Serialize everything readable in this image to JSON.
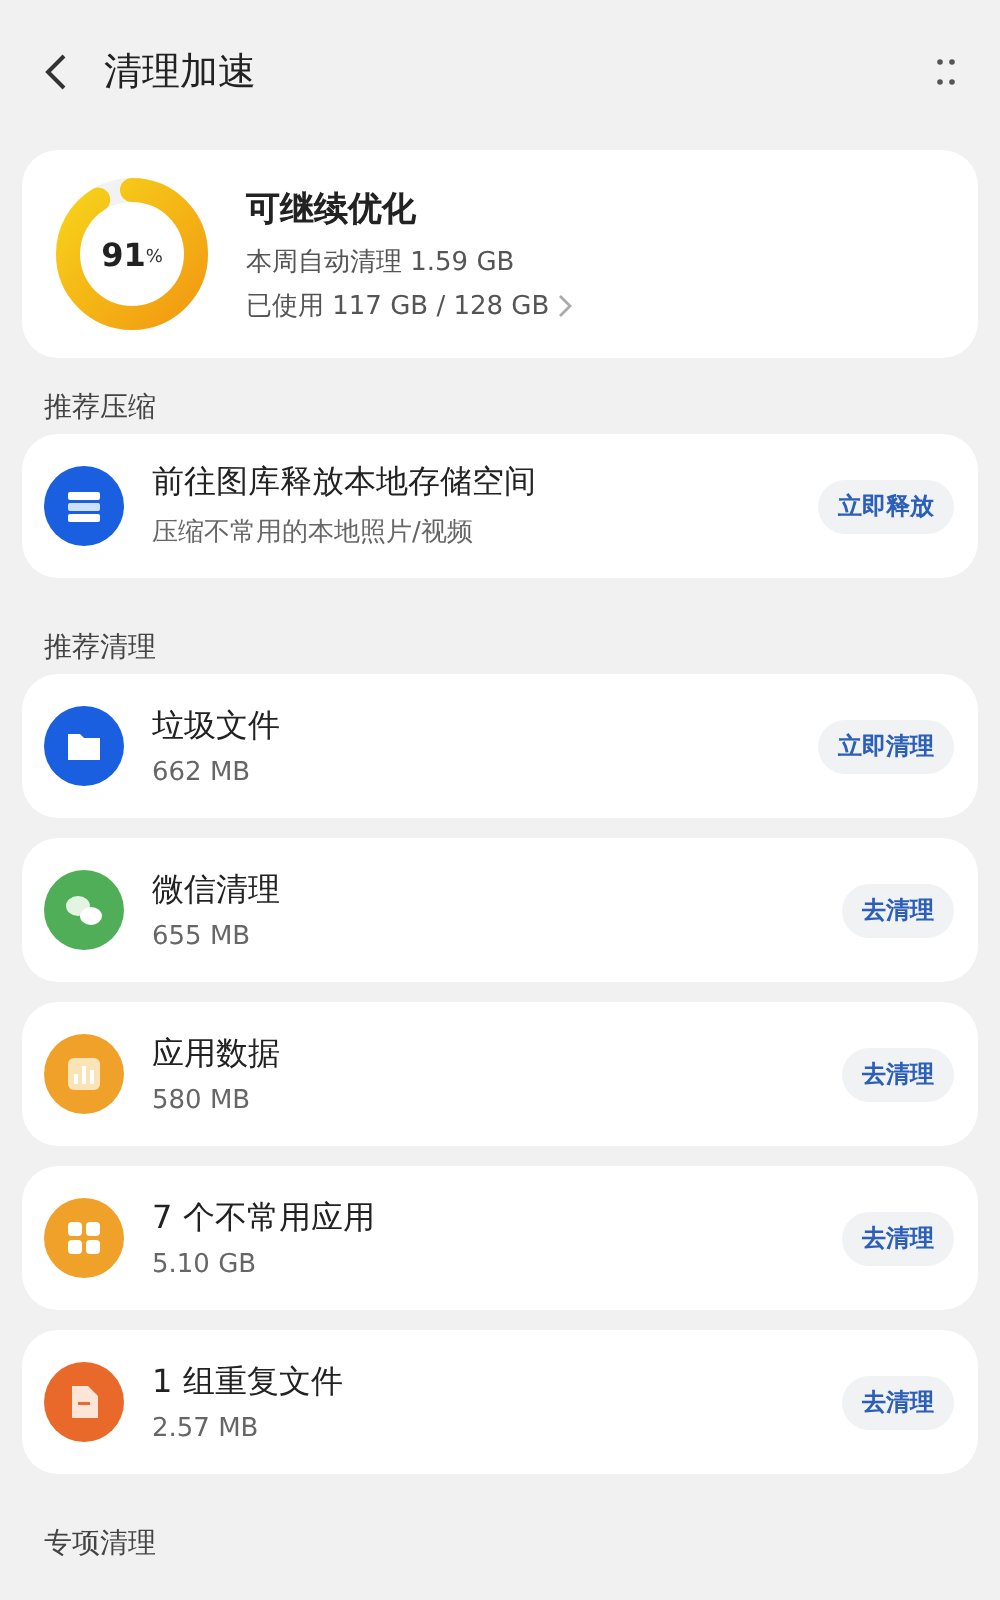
{
  "header": {
    "title": "清理加速"
  },
  "summary": {
    "level": 0.91,
    "percent": "91",
    "unit": "%",
    "title": "可继续优化",
    "weekly": "本周自动清理 1.59 GB",
    "used": "已使用 117 GB / 128 GB"
  },
  "sections": [
    {
      "title": "推荐压缩",
      "items": [
        {
          "kind": "storage",
          "color": "#1a5fe0",
          "title": "前往图库释放本地存储空间",
          "subtitle": "压缩不常用的本地照片/视频",
          "action": "立即释放"
        }
      ]
    },
    {
      "title": "推荐清理",
      "items": [
        {
          "kind": "folder",
          "color": "#1a5fe0",
          "title": "垃圾文件",
          "subtitle": "662 MB",
          "action": "立即清理"
        },
        {
          "kind": "chat",
          "color": "#4fae57",
          "title": "微信清理",
          "subtitle": "655 MB",
          "action": "去清理"
        },
        {
          "kind": "chart",
          "color": "#f0a12a",
          "title": "应用数据",
          "subtitle": "580 MB",
          "action": "去清理"
        },
        {
          "kind": "apps",
          "color": "#f0a12a",
          "title": "7 个不常用应用",
          "subtitle": "5.10 GB",
          "action": "去清理"
        },
        {
          "kind": "file",
          "color": "#e8692a",
          "title": "1 组重复文件",
          "subtitle": "2.57 MB",
          "action": "去清理"
        }
      ]
    },
    {
      "title": "专项清理"
    }
  ]
}
